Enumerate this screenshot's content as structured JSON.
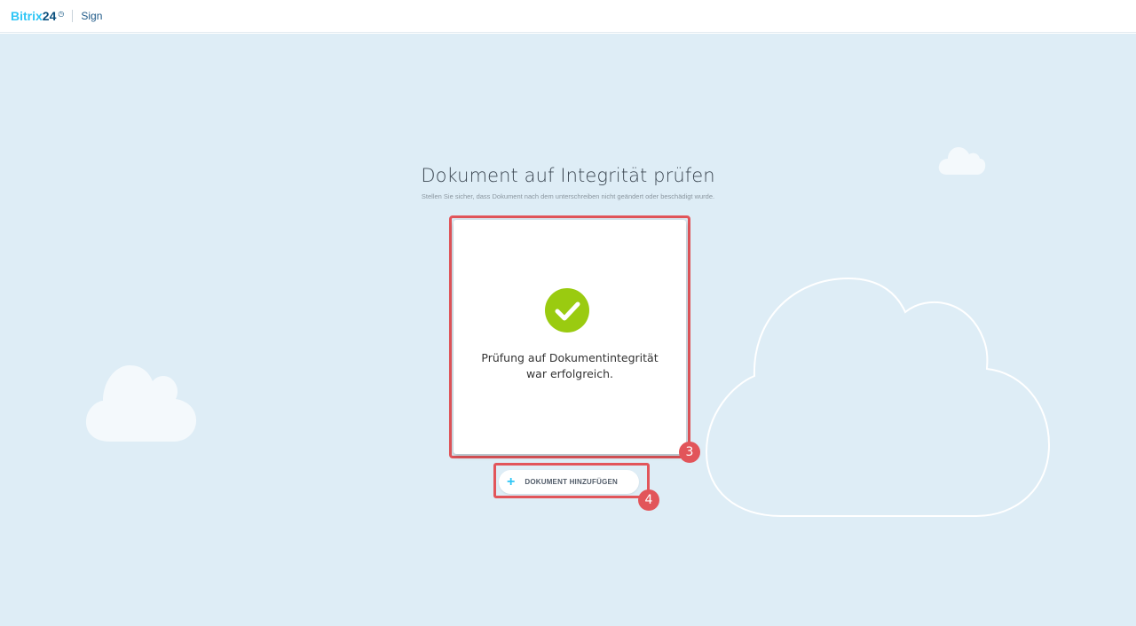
{
  "header": {
    "logo_part1": "Bitrix",
    "logo_part2": "24",
    "logo_clock": "◷",
    "product": "Sign"
  },
  "page": {
    "title": "Dokument auf Integrität prüfen",
    "subtitle": "Stellen Sie sicher, dass Dokument nach dem unterschreiben nicht geändert oder beschädigt wurde."
  },
  "result": {
    "line1": "Prüfung auf Dokumentintegrität",
    "line2": "war erfolgreich.",
    "status_color": "#9acb10"
  },
  "actions": {
    "add_icon": "+",
    "add_label": "DOKUMENT HINZUFÜGEN"
  },
  "annotations": {
    "badge_card": "3",
    "badge_button": "4",
    "highlight_color": "#e2555a"
  },
  "icons": {
    "check": "check-icon",
    "plus": "plus-icon"
  }
}
